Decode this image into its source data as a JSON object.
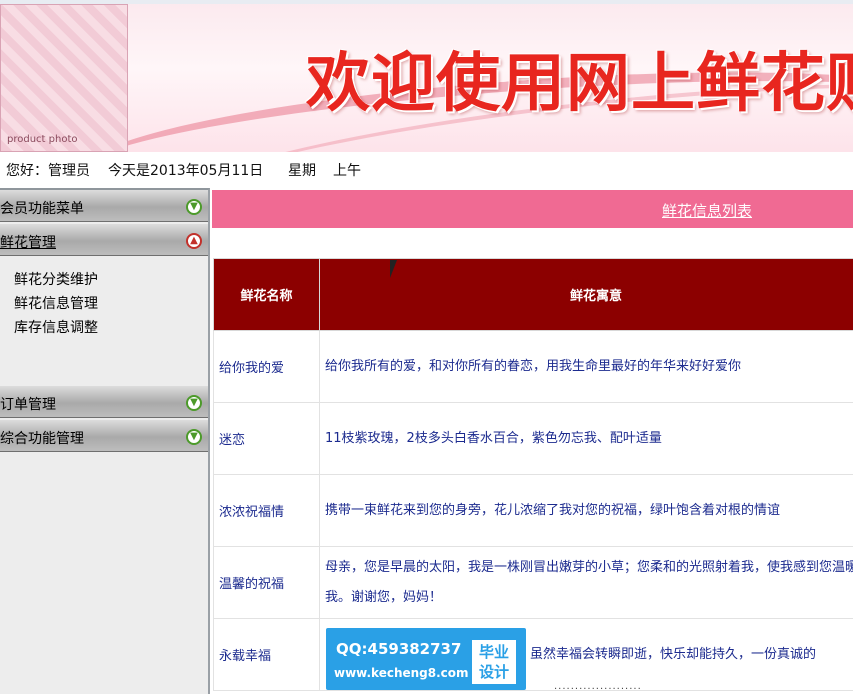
{
  "banner": {
    "title": "欢迎使用网上鲜花购物馆",
    "photo_label": "product photo"
  },
  "status": {
    "greeting": "您好：管理员",
    "date_text": "今天是2013年05月11日",
    "weekday": "星期",
    "period": "上午"
  },
  "sidebar": {
    "menus": [
      {
        "label": "会员功能菜单",
        "state": "collapsed"
      },
      {
        "label": "鲜花管理",
        "state": "expanded",
        "items": [
          "鲜花分类维护",
          "鲜花信息管理",
          "库存信息调整"
        ]
      },
      {
        "label": "订单管理",
        "state": "collapsed"
      },
      {
        "label": "综合功能管理",
        "state": "collapsed"
      }
    ]
  },
  "main": {
    "list_title": "鲜花信息列表",
    "table": {
      "headers": [
        "鲜花名称",
        "鲜花寓意"
      ],
      "rows": [
        {
          "name": "给你我的爱",
          "meaning": "给你我所有的爱，和对你所有的眷恋，用我生命里最好的年华来好好爱你"
        },
        {
          "name": "迷恋",
          "meaning": "11枝紫玫瑰，2枝多头白香水百合，紫色勿忘我、配叶适量"
        },
        {
          "name": "浓浓祝福情",
          "meaning": "携带一束鲜花来到您的身旁，花儿浓缩了我对您的祝福，绿叶饱含着对根的情谊"
        },
        {
          "name": "温馨的祝福",
          "meaning": "母亲，您是早晨的太阳，我是一株刚冒出嫩芽的小草；您柔和的光照射着我，使我感到您温暖着我。谢谢您，妈妈！"
        },
        {
          "name": "永载幸福",
          "meaning": "虽然幸福会转瞬即逝，快乐却能持久，一份真诚的"
        }
      ]
    }
  },
  "watermark": {
    "qq": "QQ:459382737",
    "url": "www.kecheng8.com",
    "badge_line1": "毕业",
    "badge_line2": "设计"
  },
  "colors": {
    "title_red": "#e8261f",
    "header_pink": "#f06a93",
    "table_header": "#8c0000",
    "cell_text": "#1c2b8f"
  }
}
